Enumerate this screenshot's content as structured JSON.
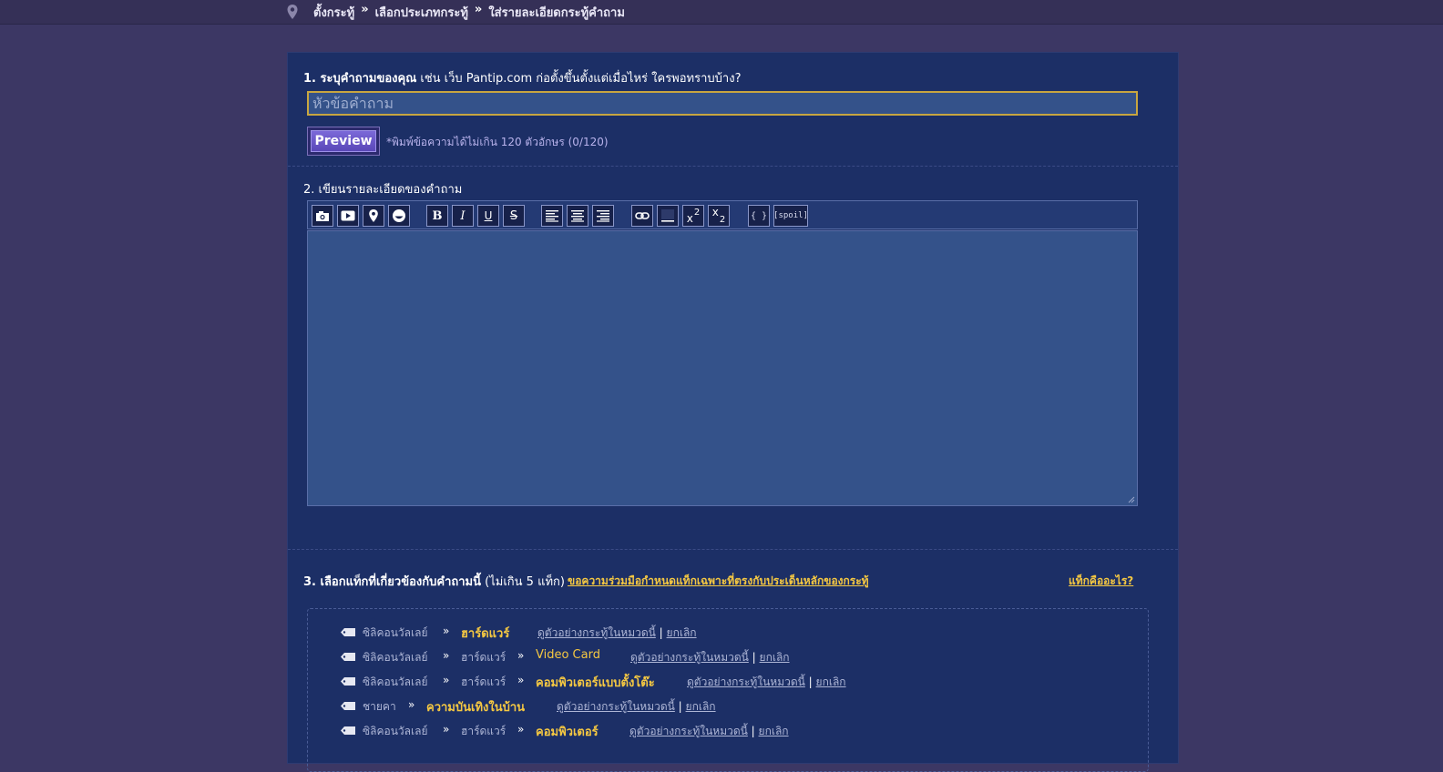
{
  "breadcrumb": {
    "items": [
      "ตั้งกระทู้",
      "เลือกประเภทกระทู้",
      "ใส่รายละเอียดกระทู้คำถาม"
    ],
    "separator": "»"
  },
  "section1": {
    "label_bold": "1. ระบุคำถามของคุณ",
    "label_rest": " เช่น เว็บ Pantip.com ก่อตั้งขึ้นตั้งแต่เมื่อไหร่ ใครพอทราบบ้าง?",
    "title_placeholder": "หัวข้อคำถาม",
    "title_value": "",
    "preview_label": "Preview",
    "hint": "*พิมพ์ข้อความได้ไม่เกิน 120 ตัวอักษร (0/120)"
  },
  "section2": {
    "label": "2. เขียนรายละเอียดของคำถาม",
    "body_value": "",
    "toolbar": {
      "bold": "B",
      "italic": "I",
      "underline": "U",
      "strike": "S",
      "sup_base": "x",
      "sup_exp": "2",
      "sub_base": "x",
      "sub_exp": "2",
      "code": "{ }",
      "spoil": "[spoil]"
    }
  },
  "section3": {
    "label_bold": "3. เลือกแท็กที่เกี่ยวข้องกับคำถามนี้",
    "label_rest": " (ไม่เกิน 5 แท็ก)",
    "cooperation_link": "ขอความร่วมมือกำหนดแท็กเฉพาะที่ตรงกับประเด็นหลักของกระทู้",
    "what_is_tag_link": "แท็กคืออะไร?",
    "view_link": "ดูตัวอย่างกระทู้ในหมวดนี้",
    "cancel_link": "ยกเลิก",
    "tags": [
      {
        "path": [
          "ซิลิคอนวัลเลย์"
        ],
        "selected": "ฮาร์ดแวร์"
      },
      {
        "path": [
          "ซิลิคอนวัลเลย์",
          "ฮาร์ดแวร์"
        ],
        "selected": "Video Card"
      },
      {
        "path": [
          "ซิลิคอนวัลเลย์",
          "ฮาร์ดแวร์"
        ],
        "selected": "คอมพิวเตอร์แบบตั้งโต๊ะ"
      },
      {
        "path": [
          "ชายคา"
        ],
        "selected": "ความบันเทิงในบ้าน"
      },
      {
        "path": [
          "ซิลิคอนวัลเลย์",
          "ฮาร์ดแวร์"
        ],
        "selected": "คอมพิวเตอร์"
      }
    ]
  },
  "colors": {
    "page_bg": "#3c3764",
    "panel_bg": "#1c2f66",
    "input_bg": "#34528a",
    "accent_yellow": "#f5c842",
    "preview_purple": "#6a58c8"
  }
}
